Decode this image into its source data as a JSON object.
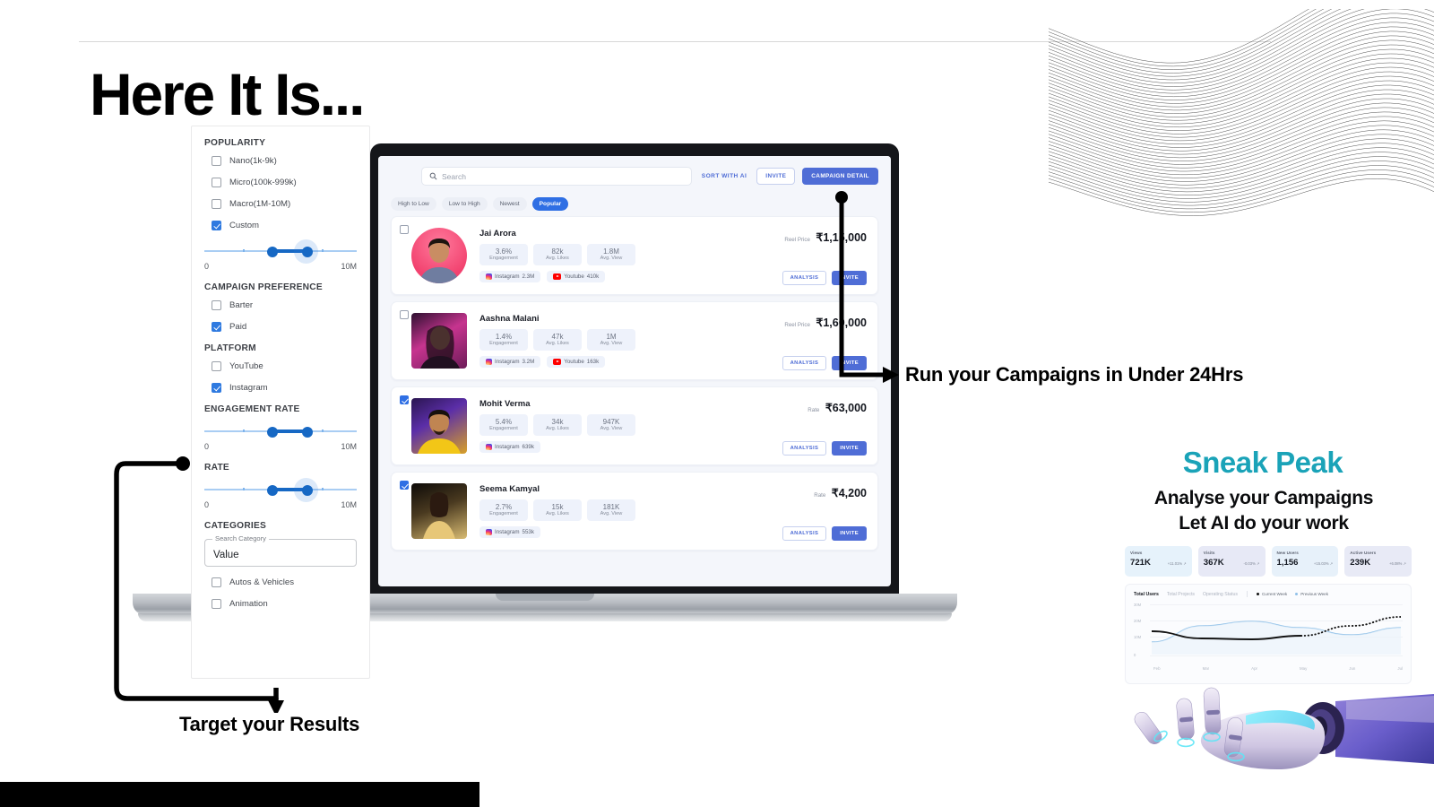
{
  "headline": "Here It Is...",
  "filter_panel": {
    "sections": [
      {
        "title": "POPULARITY",
        "options": [
          {
            "label": "Nano(1k-9k)",
            "checked": false
          },
          {
            "label": "Micro(100k-999k)",
            "checked": false
          },
          {
            "label": "Macro(1M-10M)",
            "checked": false
          },
          {
            "label": "Custom",
            "checked": true
          }
        ],
        "slider": {
          "min_label": "0",
          "max_label": "10M"
        }
      },
      {
        "title": "CAMPAIGN PREFERENCE",
        "options": [
          {
            "label": "Barter",
            "checked": false
          },
          {
            "label": "Paid",
            "checked": true
          }
        ]
      },
      {
        "title": "PLATFORM",
        "options": [
          {
            "label": "YouTube",
            "checked": false
          },
          {
            "label": "Instagram",
            "checked": true
          }
        ]
      },
      {
        "title": "ENGAGEMENT RATE",
        "slider": {
          "min_label": "0",
          "max_label": "10M"
        }
      },
      {
        "title": "RATE",
        "slider": {
          "min_label": "0",
          "max_label": "10M"
        }
      },
      {
        "title": "CATEGORIES",
        "search_label": "Search Category",
        "search_value": "Value",
        "options": [
          {
            "label": "Autos & Vehicles",
            "checked": false
          },
          {
            "label": "Animation",
            "checked": false
          }
        ]
      }
    ]
  },
  "app": {
    "search_placeholder": "Search",
    "sort_with_ai": "SORT  WITH AI",
    "invite_label": "INVITE",
    "campaign_detail_label": "CAMPAIGN DETAIL",
    "chips": [
      {
        "label": "High to Low",
        "active": false
      },
      {
        "label": "Low to High",
        "active": false
      },
      {
        "label": "Newest",
        "active": false
      },
      {
        "label": "Popular",
        "active": true
      }
    ],
    "analysis_label": "ANALYSIS",
    "card_invite_label": "INVITE",
    "influencers": [
      {
        "name": "Jai Arora",
        "selected": false,
        "avatar_shape": "round",
        "price_label": "Reel Price",
        "price": "₹1,15,000",
        "stats": [
          {
            "value": "3.6%",
            "label": "Engagement"
          },
          {
            "value": "82k",
            "label": "Avg. Likes"
          },
          {
            "value": "1.8M",
            "label": "Avg. View"
          }
        ],
        "platforms": [
          {
            "name": "Instagram",
            "icon": "instagram-icon",
            "count": "2.3M"
          },
          {
            "name": "Youtube",
            "icon": "youtube-icon",
            "count": "410k"
          }
        ]
      },
      {
        "name": "Aashna Malani",
        "selected": false,
        "avatar_shape": "rect",
        "price_label": "Reel Price",
        "price": "₹1,60,000",
        "stats": [
          {
            "value": "1.4%",
            "label": "Engagement"
          },
          {
            "value": "47k",
            "label": "Avg. Likes"
          },
          {
            "value": "1M",
            "label": "Avg. View"
          }
        ],
        "platforms": [
          {
            "name": "Instagram",
            "icon": "instagram-icon",
            "count": "3.2M"
          },
          {
            "name": "Youtube",
            "icon": "youtube-icon",
            "count": "163k"
          }
        ]
      },
      {
        "name": "Mohit Verma",
        "selected": true,
        "avatar_shape": "rect",
        "price_label": "Rate",
        "price": "₹63,000",
        "stats": [
          {
            "value": "5.4%",
            "label": "Engagement"
          },
          {
            "value": "34k",
            "label": "Avg. Likes"
          },
          {
            "value": "947K",
            "label": "Avg. View"
          }
        ],
        "platforms": [
          {
            "name": "Instagram",
            "icon": "instagram-icon",
            "count": "639k"
          }
        ]
      },
      {
        "name": "Seema Kamyal",
        "selected": true,
        "avatar_shape": "rect",
        "price_label": "Rate",
        "price": "₹4,200",
        "stats": [
          {
            "value": "2.7%",
            "label": "Engagement"
          },
          {
            "value": "15k",
            "label": "Avg. Likes"
          },
          {
            "value": "181K",
            "label": "Avg. View"
          }
        ],
        "platforms": [
          {
            "name": "Instagram",
            "icon": "instagram-icon",
            "count": "553k"
          }
        ]
      }
    ]
  },
  "annotations": {
    "run_campaigns": "Run your Campaigns in Under 24Hrs",
    "target_results": "Target your Results"
  },
  "sneak": {
    "title": "Sneak Peak",
    "subtitle_line1": "Analyse your Campaigns",
    "subtitle_line2": "Let AI do your work",
    "stat_cards": [
      {
        "title": "Views",
        "value": "721K",
        "delta": "+11.01% ↗",
        "bg": "#e6f2fb"
      },
      {
        "title": "Visits",
        "value": "367K",
        "delta": "-0.03% ↗",
        "bg": "#e7e9f6"
      },
      {
        "title": "New Users",
        "value": "1,156",
        "delta": "+15.03% ↗",
        "bg": "#e7f1fa"
      },
      {
        "title": "Active Users",
        "value": "239K",
        "delta": "+6.08% ↗",
        "bg": "#e8eaf6"
      }
    ]
  },
  "chart_data": {
    "type": "line",
    "title": "Total Users",
    "tabs": [
      "Total Users",
      "Total Projects",
      "Operating Status"
    ],
    "active_tab": "Total Users",
    "legend": [
      "Current Week",
      "Previous Week"
    ],
    "legend_position": "top-right",
    "grid": true,
    "xlabel": "",
    "ylabel": "",
    "x": [
      "Feb",
      "Mar",
      "Apr",
      "May",
      "Jun",
      "Jul"
    ],
    "ytick_labels": [
      "30M",
      "20M",
      "10M",
      "0"
    ],
    "ylim": [
      0,
      30
    ],
    "series": [
      {
        "name": "Current Week",
        "color": "#111111",
        "style": "solid-then-dotted",
        "values": [
          13,
          9,
          8.5,
          10.5,
          16,
          21
        ]
      },
      {
        "name": "Previous Week",
        "color": "#8fc0e8",
        "style": "solid",
        "values": [
          7,
          16,
          18.5,
          15,
          11,
          15
        ]
      }
    ]
  },
  "colors": {
    "accent_blue": "#4f6dd6",
    "slider_blue": "#1668c4",
    "teal": "#1aa3b8",
    "chip_active": "#2f6fe4"
  }
}
